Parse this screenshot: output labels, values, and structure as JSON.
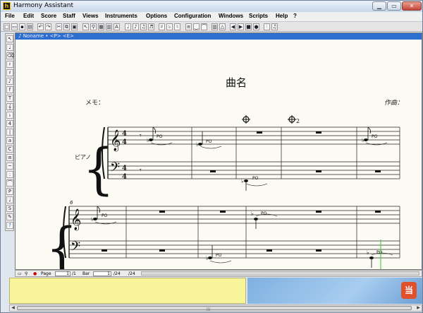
{
  "window": {
    "title": "Harmony Assistant",
    "app_icon": "h"
  },
  "window_buttons": {
    "minimize": "▁",
    "maximize": "▭",
    "close": "✕"
  },
  "menu": [
    "File",
    "Edit",
    "Score",
    "Staff",
    "Views",
    "Instruments",
    "Options",
    "Configuration",
    "Windows",
    "Scripts",
    "Help",
    "?"
  ],
  "toolbar_icons": [
    "new-icon",
    "open-icon",
    "save-icon",
    "print-icon",
    "undo-icon",
    "cut-icon",
    "copy-icon",
    "paste-icon",
    "note-icon",
    "rest-icon",
    "chord-icon",
    "keyboard-icon",
    "play-icon",
    "stop-icon"
  ],
  "palette_icons": [
    "pointer-icon",
    "note-tool-icon",
    "eraser-icon",
    "rest-tool-icon",
    "accidental-icon",
    "tie-icon",
    "dynamics-icon",
    "text-icon",
    "clef-icon",
    "key-icon",
    "time-icon",
    "bar-icon",
    "lyrics-icon",
    "chord-icon",
    "staff-icon",
    "ornament-icon",
    "slur-icon",
    "help-icon"
  ],
  "document": {
    "tab_title": "♪ Noname • <P> <E>"
  },
  "score": {
    "title": "曲名",
    "memo_label": "メモ：",
    "composer_label": "作曲：",
    "instrument_label": "ピアノ",
    "measure_number": "6",
    "coda_label": "2",
    "note_syllable": "PO"
  },
  "status_bar": {
    "page_label": "Page",
    "page_value": "1",
    "page_total": "/1",
    "bar_label": "Bar",
    "bar_value": "1",
    "bar_total": "/24",
    "bar_total2": "/24"
  },
  "taskbar_logo": "当"
}
